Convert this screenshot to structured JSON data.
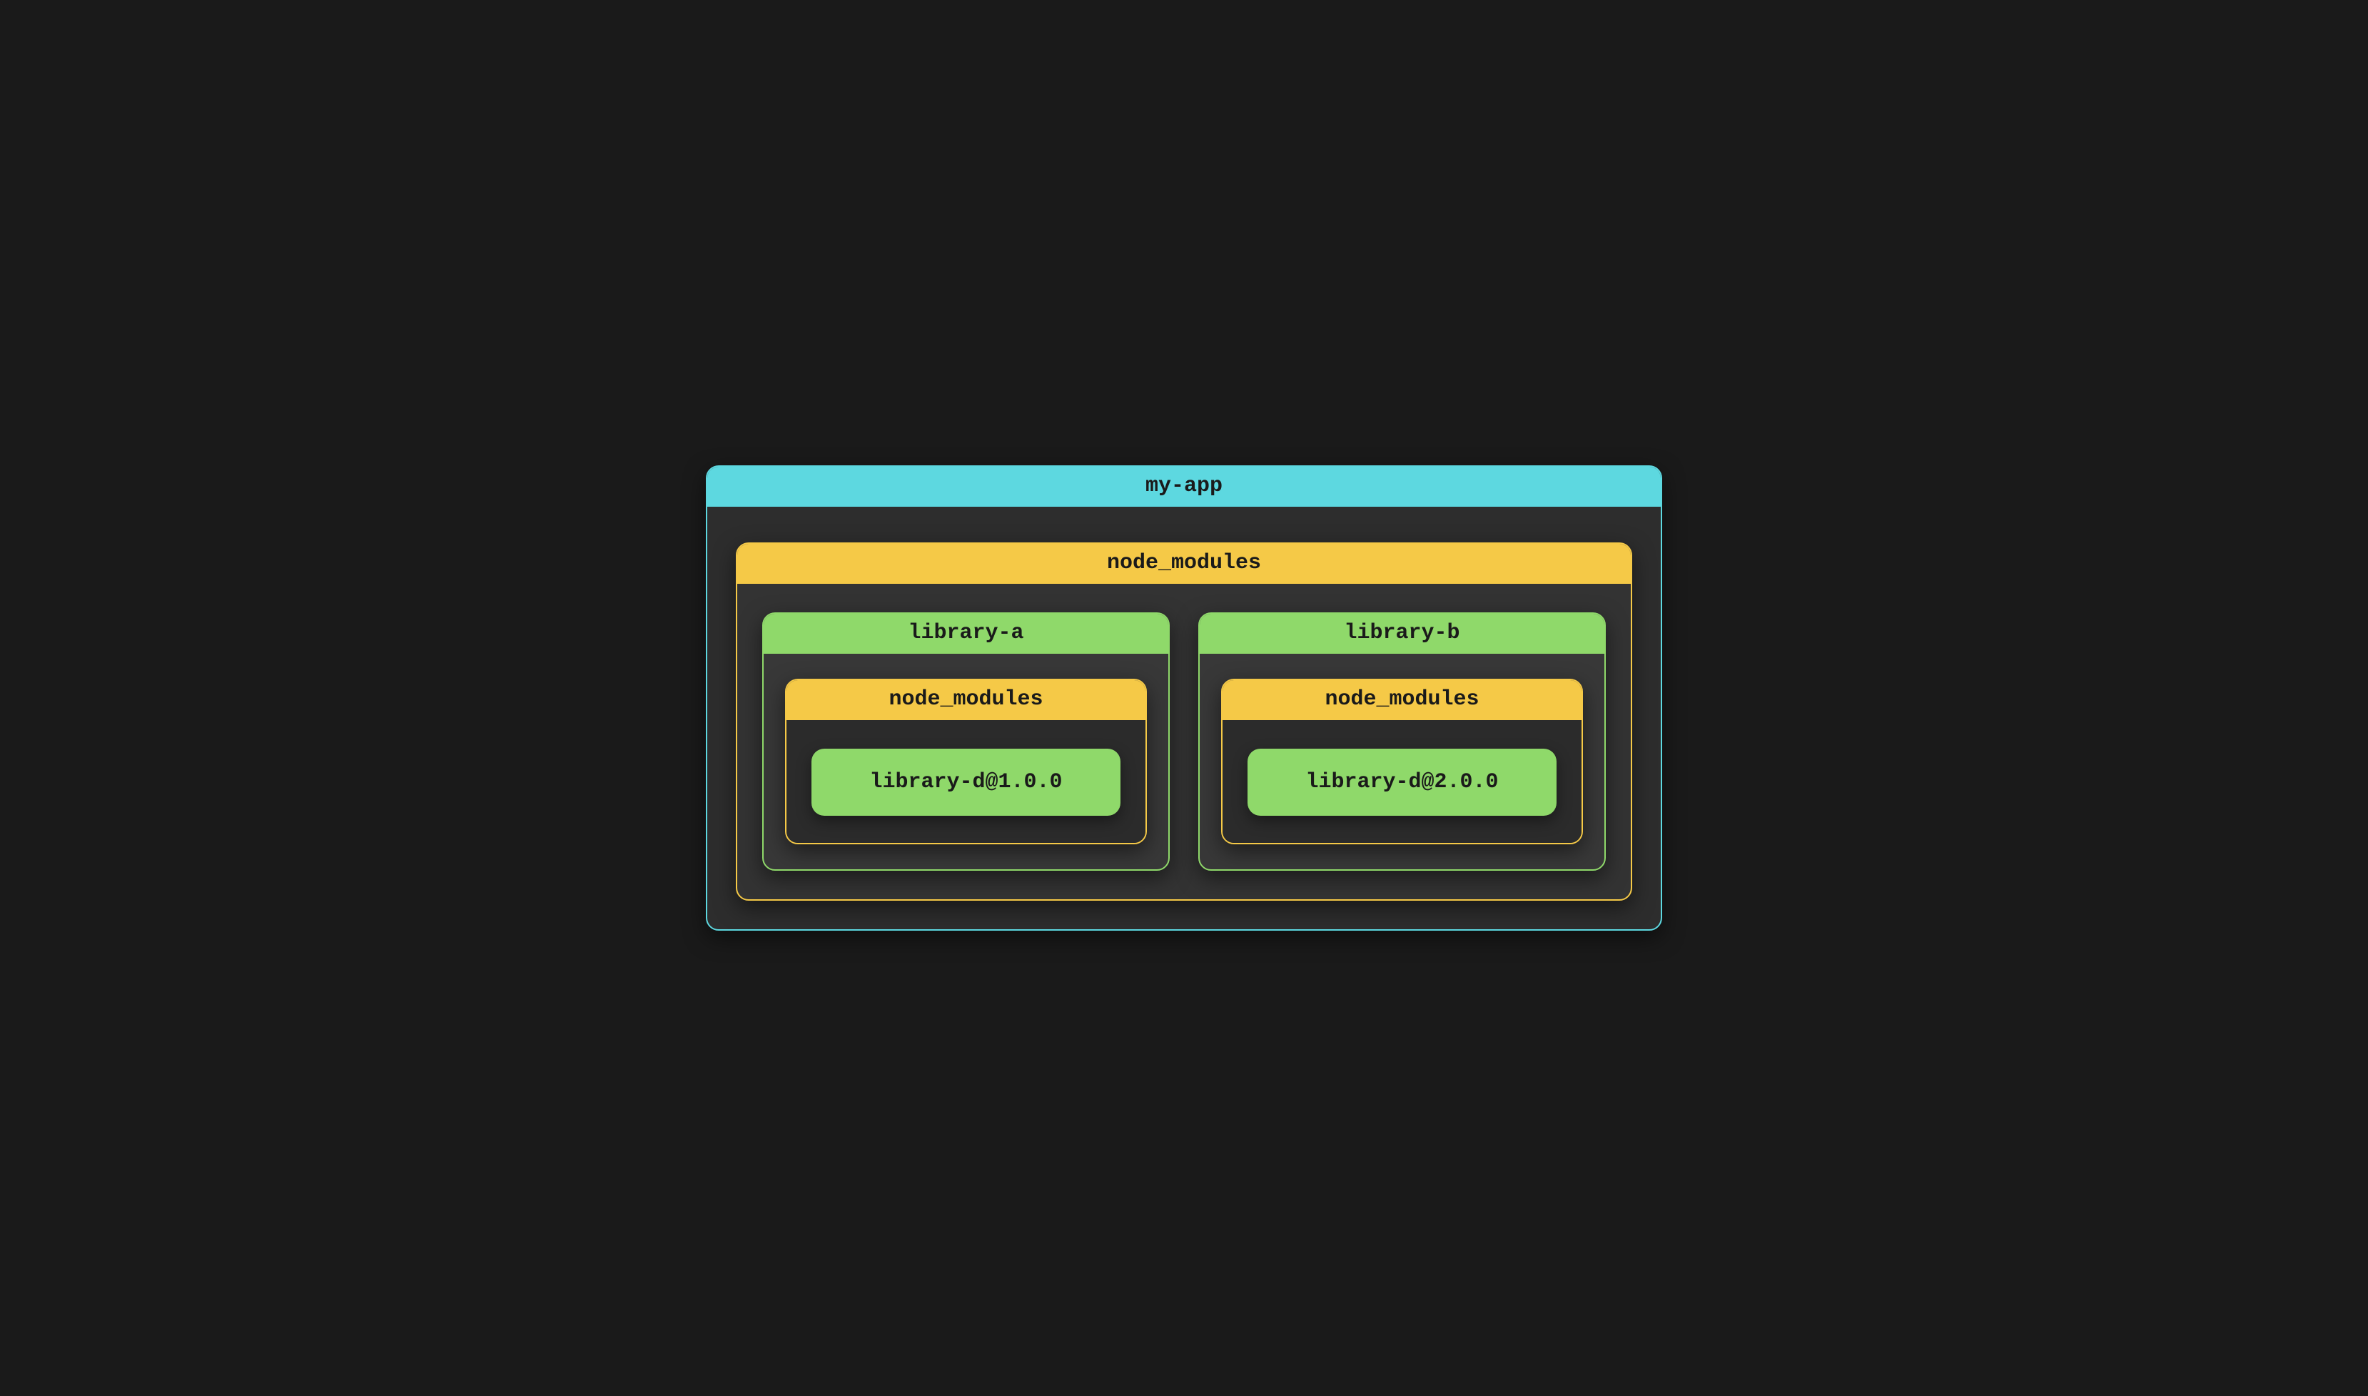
{
  "app": {
    "name": "my-app",
    "node_modules_label": "node_modules",
    "libraries": {
      "a": {
        "name": "library-a",
        "node_modules_label": "node_modules",
        "package": "library-d@1.0.0"
      },
      "b": {
        "name": "library-b",
        "node_modules_label": "node_modules",
        "package": "library-d@2.0.0"
      }
    }
  },
  "colors": {
    "cyan": "#5dd8e0",
    "yellow": "#f5c947",
    "green": "#8fd96a",
    "bg_dark": "#1a1a1a",
    "bg_panel": "#2d2d2d"
  }
}
